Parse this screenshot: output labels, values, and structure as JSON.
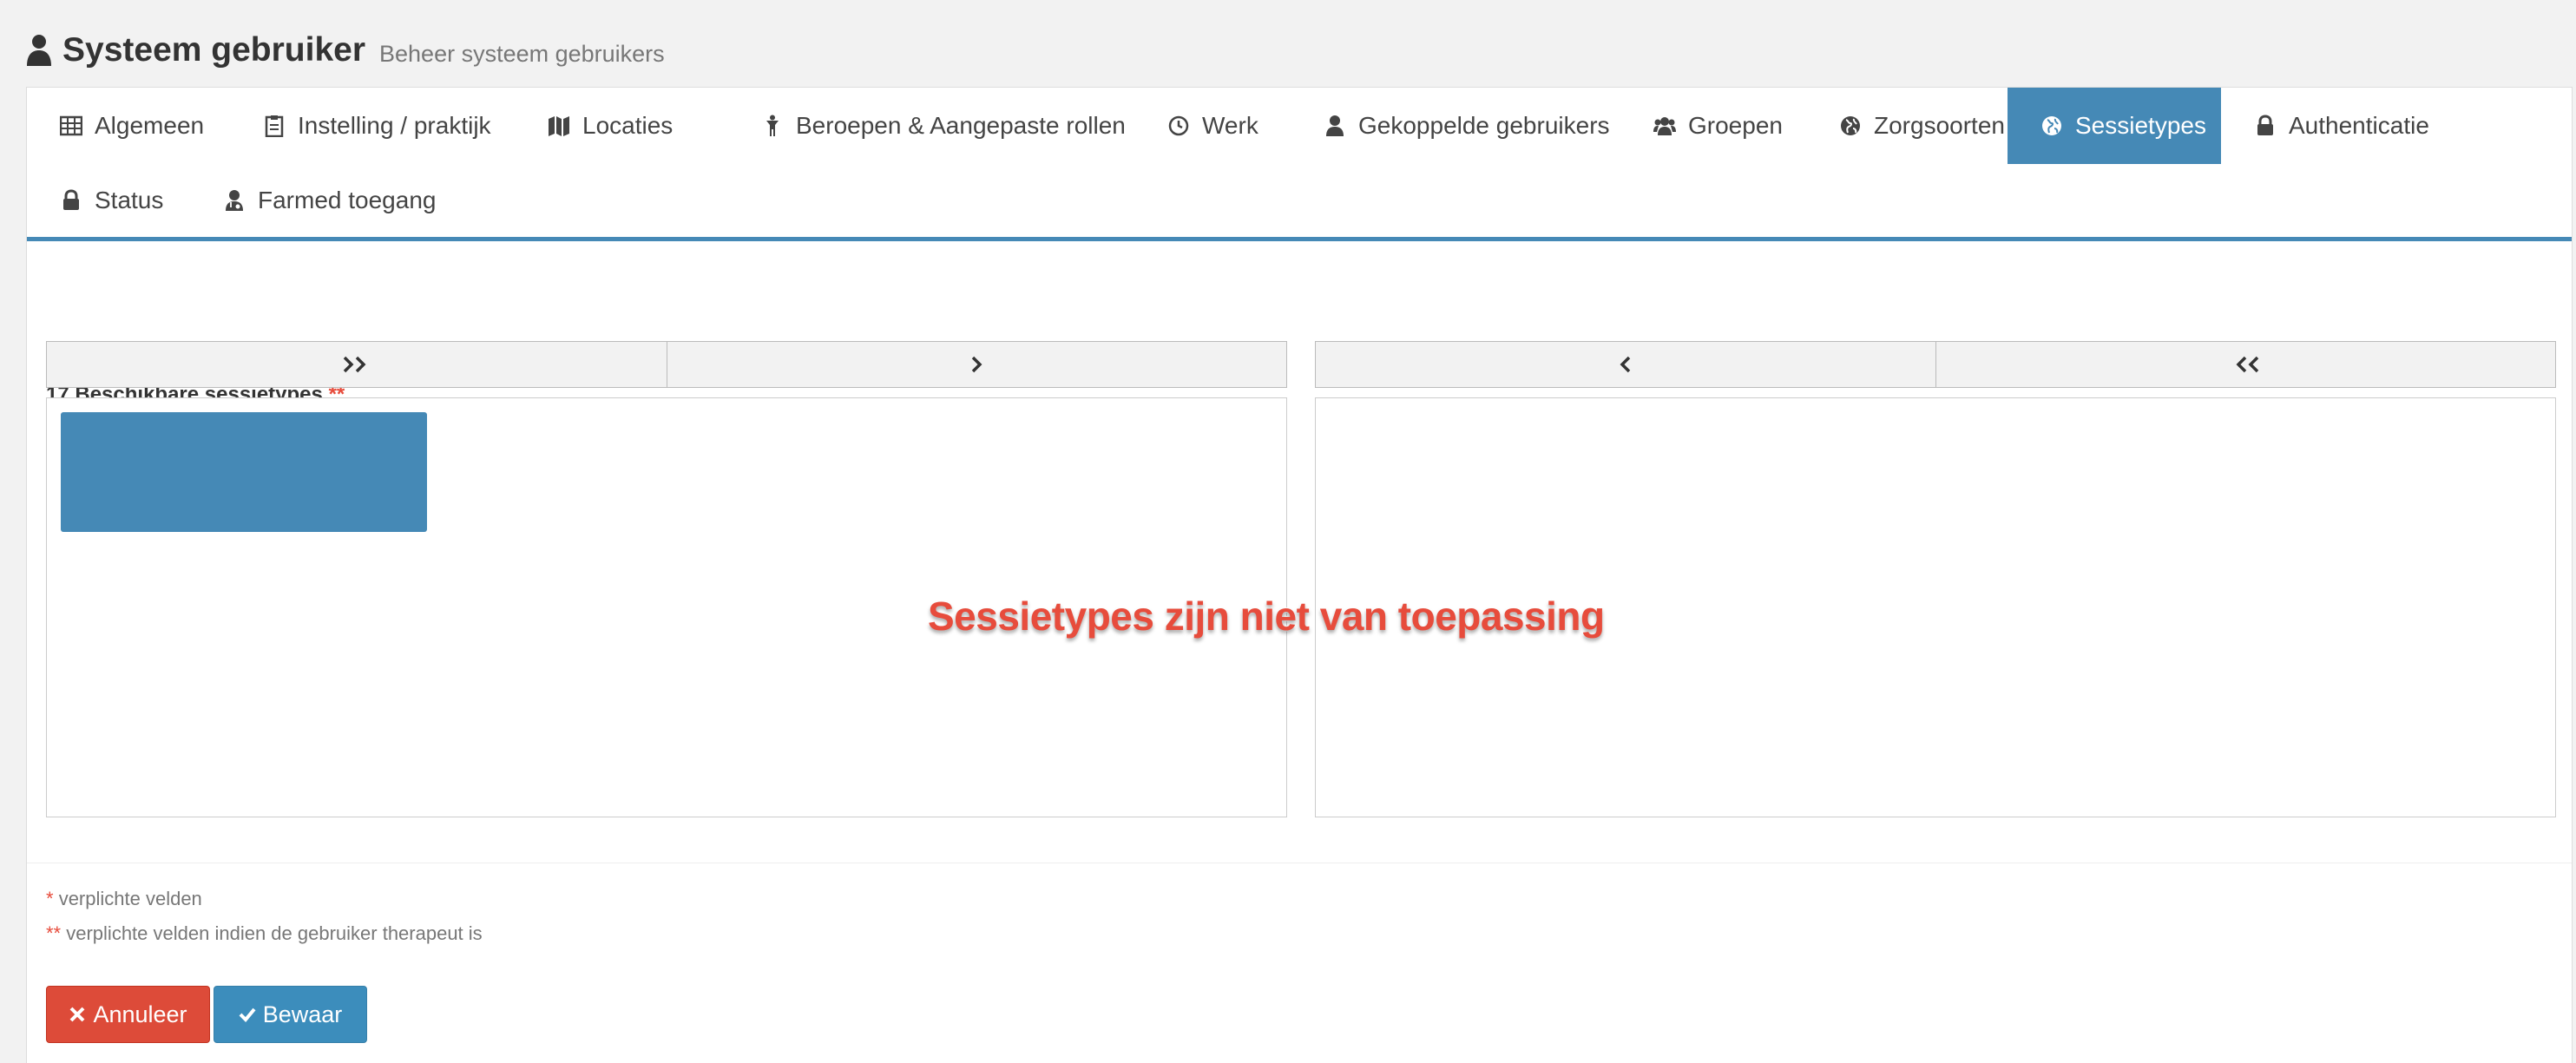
{
  "header": {
    "title": "Systeem gebruiker",
    "subtitle": "Beheer systeem gebruikers"
  },
  "tabs": [
    {
      "label": "Algemeen",
      "icon": "table-icon"
    },
    {
      "label": "Instelling / praktijk",
      "icon": "clipboard-icon"
    },
    {
      "label": "Locaties",
      "icon": "map-icon"
    },
    {
      "label": "Beroepen & Aangepaste rollen",
      "icon": "person-icon"
    },
    {
      "label": "Werk",
      "icon": "clock-icon"
    },
    {
      "label": "Gekoppelde gebruikers",
      "icon": "user-icon"
    },
    {
      "label": "Groepen",
      "icon": "users-icon"
    },
    {
      "label": "Zorgsoorten",
      "icon": "globe-icon"
    },
    {
      "label": "Sessietypes",
      "icon": "globe-icon",
      "active": true
    },
    {
      "label": "Authenticatie",
      "icon": "lock-icon"
    },
    {
      "label": "Status",
      "icon": "lock-icon"
    },
    {
      "label": "Farmed toegang",
      "icon": "user-md-icon"
    }
  ],
  "sessietypes": {
    "label": "17 Beschikbare sessietypes",
    "required_marker": "**",
    "overlay_message": "Sessietypes zijn niet van toepassing"
  },
  "notes": {
    "required_marker": "*",
    "required_text": "verplichte velden",
    "therapist_marker": "**",
    "therapist_text": "verplichte velden indien de gebruiker therapeut is"
  },
  "buttons": {
    "cancel_label": "Annuleer",
    "save_label": "Bewaar"
  },
  "colors": {
    "accent": "#4589b6",
    "danger": "#dd4b39",
    "primary": "#3c8dbc"
  }
}
